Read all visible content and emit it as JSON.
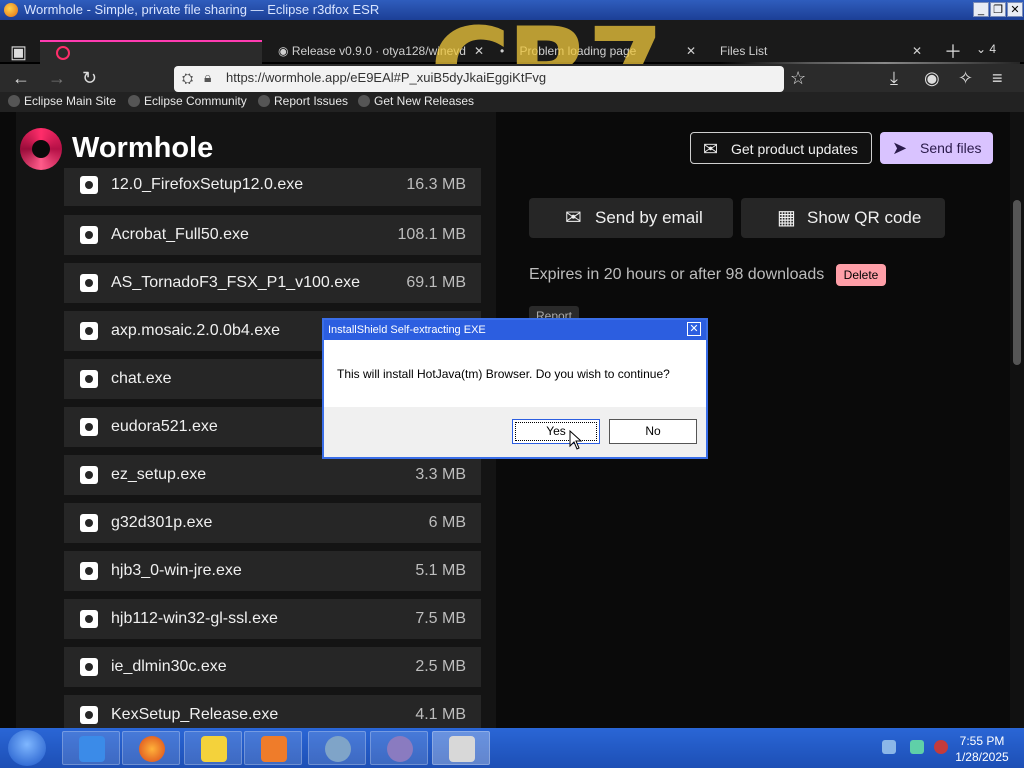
{
  "window": {
    "title": "Wormhole - Simple, private file sharing — Eclipse r3dfox ESR",
    "controls": [
      "_",
      "❐",
      "✕"
    ]
  },
  "tabs": [
    {
      "label": "",
      "active": true
    },
    {
      "label": "Release v0.9.0 · otya128/winevd"
    },
    {
      "label": "Problem loading page"
    },
    {
      "label": "Files List"
    }
  ],
  "tab_count": "4",
  "url": "https://wormhole.app/eE9EAl#P_xuiB5dyJkaiEggiKtFvg",
  "bookmarks": [
    "Eclipse Main Site",
    "Eclipse Community",
    "Report Issues",
    "Get New Releases"
  ],
  "background_art": {
    "text": "CR7"
  },
  "header": {
    "brand": "Wormhole",
    "updates_label": "Get product updates",
    "send_label": "Send files"
  },
  "files": [
    {
      "name": "12.0_FirefoxSetup12.0.exe",
      "size": "16.3 MB"
    },
    {
      "name": "Acrobat_Full50.exe",
      "size": "108.1 MB"
    },
    {
      "name": "AS_TornadoF3_FSX_P1_v100.exe",
      "size": "69.1 MB"
    },
    {
      "name": "axp.mosaic.2.0.0b4.exe",
      "size": ""
    },
    {
      "name": "chat.exe",
      "size": ""
    },
    {
      "name": "eudora521.exe",
      "size": ""
    },
    {
      "name": "ez_setup.exe",
      "size": "3.3 MB"
    },
    {
      "name": "g32d301p.exe",
      "size": "6 MB"
    },
    {
      "name": "hjb3_0-win-jre.exe",
      "size": "5.1 MB"
    },
    {
      "name": "hjb112-win32-gl-ssl.exe",
      "size": "7.5 MB"
    },
    {
      "name": "ie_dlmin30c.exe",
      "size": "2.5 MB"
    },
    {
      "name": "KexSetup_Release.exe",
      "size": "4.1 MB"
    }
  ],
  "actions": {
    "email_label": "Send by email",
    "qr_label": "Show QR code",
    "expires": "Expires in 20 hours or after 98 downloads",
    "delete_label": "Delete",
    "report_label": "Report"
  },
  "dialog": {
    "title": "InstallShield Self-extracting EXE",
    "message": "This will install HotJava(tm) Browser. Do you wish to continue?",
    "yes_label": "Yes",
    "no_label": "No",
    "close": "✕"
  },
  "taskbar": {
    "time": "7:55 PM",
    "date": "1/28/2025"
  },
  "colors": {
    "accent": "#d9c3ff",
    "delete": "#ff9fa8",
    "brand_logo": "#ff2d6a",
    "taskbar": "#2a66d6"
  }
}
